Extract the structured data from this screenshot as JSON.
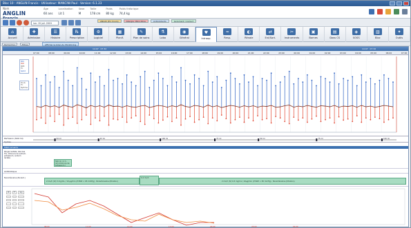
{
  "window": {
    "title": "Bloc 10 : ANGLIN Francis  · Utilisateur: MANCINI Paul  · Version: 6.1.23"
  },
  "patient": {
    "label": "Nom",
    "last_name": "ANGLIN",
    "first_name": "Francis",
    "fields": [
      {
        "label": "Âge",
        "value": "60 ans"
      },
      {
        "label": "Localisation",
        "value": "Lit 1"
      },
      {
        "label": "Sexe",
        "value": "M"
      },
      {
        "label": "Taille",
        "value": "178 cm"
      },
      {
        "label": "Poids",
        "value": "80 kg"
      },
      {
        "label": "Poids théorique",
        "value": "74,4 kg"
      }
    ]
  },
  "toolbar": {
    "date_value": "lun. 15 juil. 2019",
    "alerts": [
      "ANGIO (En Cours)",
      "Allergie: Pénicilline",
      "Antécédents",
      "Isolement: Contact"
    ],
    "alert_colors": [
      "#f2d89a",
      "#f5b4b4",
      "#cfe0f5",
      "#c9ecd7"
    ]
  },
  "modules": [
    {
      "label": "Accueil",
      "icon": "home-icon",
      "glyph": "⌂"
    },
    {
      "label": "Admission",
      "icon": "admission-icon",
      "glyph": "✚"
    },
    {
      "label": "Histoire",
      "icon": "history-icon",
      "glyph": "☰"
    },
    {
      "label": "Prescription",
      "icon": "prescription-icon",
      "glyph": "℞"
    },
    {
      "label": "Logiciel",
      "icon": "software-icon",
      "glyph": "⚙"
    },
    {
      "label": "Planif.",
      "icon": "planning-icon",
      "glyph": "▦"
    },
    {
      "label": "Plan de soins",
      "icon": "care-plan-icon",
      "glyph": "✎"
    },
    {
      "label": "Labo",
      "icon": "lab-icon",
      "glyph": "⚗"
    },
    {
      "label": "Général",
      "icon": "general-icon",
      "glyph": "◉"
    },
    {
      "label": "Intraop.",
      "icon": "intraop-icon",
      "glyph": "♥"
    },
    {
      "label": "Resp.",
      "icon": "respiratory-icon",
      "glyph": "≈"
    },
    {
      "label": "Rénale",
      "icon": "renal-icon",
      "glyph": "◐"
    },
    {
      "label": "Ent/Sort.",
      "icon": "in-out-icon",
      "glyph": "⇄"
    },
    {
      "label": "Instruments",
      "icon": "instruments-icon",
      "glyph": "✂"
    },
    {
      "label": "Bornes",
      "icon": "bornes-icon",
      "glyph": "▣"
    },
    {
      "label": "Doss CS",
      "icon": "folder-icon",
      "glyph": "▤"
    },
    {
      "label": "SOSS",
      "icon": "soss-icon",
      "glyph": "◈"
    },
    {
      "label": "Bloc",
      "icon": "bloc-icon",
      "glyph": "▥"
    },
    {
      "label": "Outils",
      "icon": "tools-icon",
      "glyph": "✦"
    }
  ],
  "active_module": 9,
  "subbar": {
    "pill1": "Rechercher",
    "pill2": "Filtres",
    "tab": "Afficher le bilan du Monitoring"
  },
  "panel": {
    "left_time": "14:07 · 07:32",
    "right_time": "14:07 · 07:32",
    "times": [
      "07:00",
      "08:00",
      "09:00",
      "10:00",
      "11:00",
      "12:00",
      "13:00",
      "14:00",
      "15:00",
      "16:00",
      "17:00",
      "18:00",
      "19:00",
      "20:00",
      "21:00",
      "22:00",
      "23:00",
      "00:00",
      "01:00",
      "02:00",
      "03:00",
      "04:00",
      "05:00",
      "06:00",
      "07:00"
    ]
  },
  "vitals_legend": {
    "items": [
      "PAS",
      "PAD",
      "PAM",
      "FC",
      "SpO2"
    ],
    "pulse_label": "Pouls",
    "pulse_items": [
      "FC",
      "Rythme"
    ]
  },
  "vitals_data": {
    "systolic": [
      170,
      150,
      180,
      160,
      175,
      145,
      190,
      165,
      150,
      200,
      170,
      140,
      185,
      160,
      175,
      150,
      195,
      165,
      170,
      155,
      180,
      160,
      150,
      175,
      190,
      145,
      165,
      185,
      170,
      150,
      175,
      160,
      200,
      165,
      155,
      180,
      170,
      150,
      190,
      160,
      175,
      145,
      165,
      185,
      170,
      155,
      180,
      160,
      175,
      150,
      170,
      165,
      185,
      150,
      160,
      175,
      190,
      155,
      170,
      160,
      180,
      165,
      150,
      175,
      170,
      160,
      185,
      155,
      170,
      165,
      175,
      150,
      180,
      160,
      170,
      155,
      165,
      180,
      170,
      160
    ],
    "diastolic": [
      55,
      60,
      45,
      65,
      50,
      70,
      40,
      58,
      62,
      45,
      55,
      68,
      42,
      60,
      52,
      65,
      40,
      57,
      55,
      62,
      48,
      60,
      66,
      50,
      42,
      68,
      58,
      46,
      54,
      63,
      50,
      60,
      40,
      57,
      64,
      48,
      55,
      62,
      44,
      60,
      52,
      68,
      58,
      46,
      55,
      62,
      48,
      60,
      52,
      66,
      55,
      58,
      46,
      64,
      60,
      50,
      44,
      62,
      54,
      60,
      48,
      57,
      65,
      50,
      55,
      60,
      46,
      63,
      54,
      57,
      50,
      66,
      48,
      60,
      55,
      62,
      58,
      48,
      55,
      60
    ],
    "mean": [
      92,
      90,
      95,
      91,
      94,
      89,
      96,
      92,
      90,
      97,
      93,
      88,
      95,
      91,
      94,
      90,
      96,
      92,
      93,
      90,
      94,
      91,
      90,
      93,
      95,
      89,
      92,
      95,
      93,
      90,
      94,
      91,
      97,
      92,
      90,
      95,
      93,
      90,
      96,
      91,
      94,
      89,
      92,
      95,
      93,
      90,
      94,
      91,
      94,
      90,
      93,
      92,
      95,
      90,
      91,
      94,
      96,
      90,
      93,
      91,
      95,
      92,
      90,
      94,
      93,
      91,
      95,
      90,
      93,
      92,
      94,
      90,
      95,
      91,
      93,
      90,
      92,
      95,
      93,
      91
    ]
  },
  "fluids": {
    "label": "Perfusion (500 ml)",
    "ticks": [
      "50 ml",
      "25 ml",
      "100 ml",
      "75 ml",
      "50 ml",
      "75 ml",
      "100 ml"
    ],
    "cycles_label": "Cycles"
  },
  "section_strip": "Médicaments",
  "drugs": [
    {
      "label": "Ringer lactate, Glucose 5%, Chlorure de sodium, potassium, sodium lactate",
      "bar": "500 ml / 2 h  ·  (IV)  Chlorure de potassium / sodium / calcium"
    },
    {
      "label": "Antibiotique",
      "bar": ""
    },
    {
      "label": "Noradrénaline (Noradr.)",
      "bar": "2 mL/h (IV) 3 mg/mL / 10 µg/min (if MAP < 65 mmHg)  ·  Noradrénaline (titration)",
      "bar2": "0.4 mL/h",
      "bar3": "2 mL/h (IV) 0,5 mg/mL / 10µg/min (if MAP < 65 mmHg)  ·  Noradrénaline (titration)"
    }
  ],
  "mini_table": {
    "headers": [
      "Pt",
      "T°",
      "Gly"
    ],
    "rows": [
      [
        "",
        "",
        ""
      ],
      [
        "",
        "",
        ""
      ],
      [
        "",
        "",
        ""
      ],
      [
        "",
        "",
        ""
      ]
    ]
  },
  "mini_chart": {
    "red": [
      220,
      225,
      248,
      235,
      230,
      238,
      250,
      262,
      255,
      248,
      258,
      266,
      262,
      262
    ],
    "orange": [
      230,
      232,
      244,
      240,
      234,
      242,
      252,
      258,
      260,
      250,
      258,
      262,
      260,
      263
    ],
    "x_labels": [
      "08:00",
      "11:00",
      "14:00",
      "17:00",
      "20:00",
      "23:00",
      "02:00"
    ]
  },
  "colors": {
    "accent": "#3d6ea8",
    "systolic": "#2b5fc2",
    "diastolic": "#e0442f",
    "mean": "#444444",
    "drug": "#a8dcc2"
  }
}
